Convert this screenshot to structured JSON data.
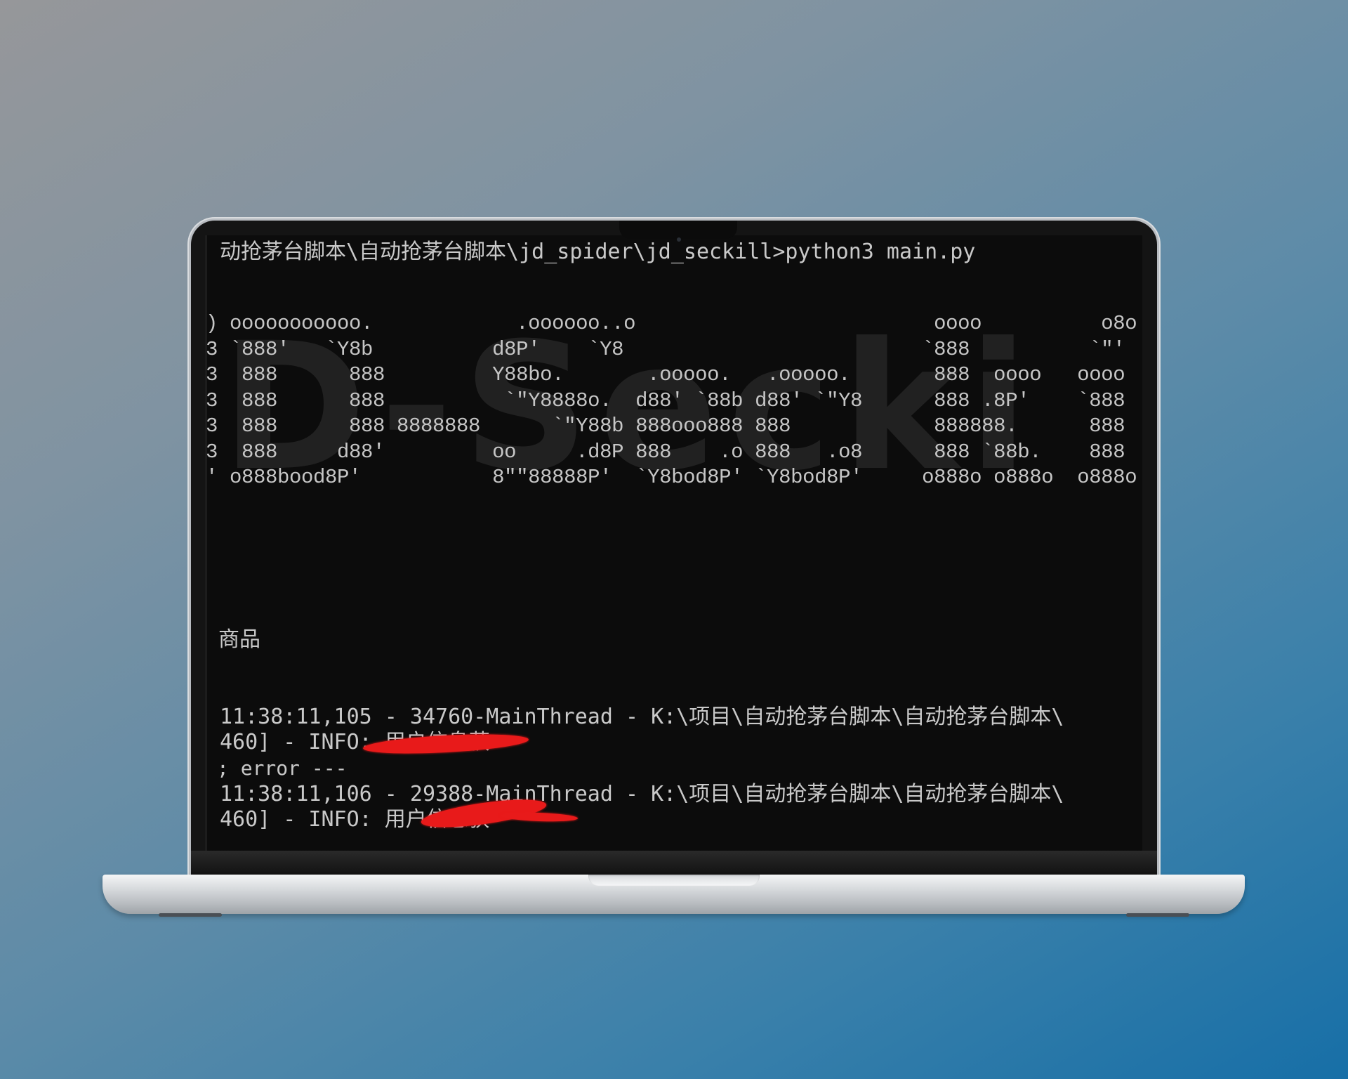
{
  "terminal": {
    "command_line": "动抢茅台脚本\\自动抢茅台脚本\\jd_spider\\jd_seckill>python3 main.py",
    "banner_art": ") ooooooooooo.            .oooooo..o                         oooo          o8o\n3 `888'   `Y8b          d8P'    `Y8                         `888          `\"'\n3  888      888         Y88bo.       .ooooo.   .ooooo.       888  oooo   oooo\n3  888      888          `\"Y8888o.  d88' `88b d88' `\"Y8      888 .8P'    `888\n3  888      888 8888888      `\"Y88b 888ooo888 888            888888.      888\n3  888     d88'         oo     .d8P 888    .o 888   .o8      888 `88b.    888\n' o888bood8P'           8\"\"88888P'  `Y8bod8P' `Y8bod8P'     o888o o888o  o888o",
    "watermark": "D-Secki",
    "prompt_line": "商品",
    "log_lines": [
      "11:38:11,105 - 34760-MainThread - K:\\项目\\自动抢茅台脚本\\自动抢茅台脚本\\",
      "460] - INFO: 用户信息获",
      "; error ---",
      "11:38:11,106 - 29388-MainThread - K:\\项目\\自动抢茅台脚本\\自动抢茅台脚本\\",
      "460] - INFO: 用户信息获"
    ]
  }
}
